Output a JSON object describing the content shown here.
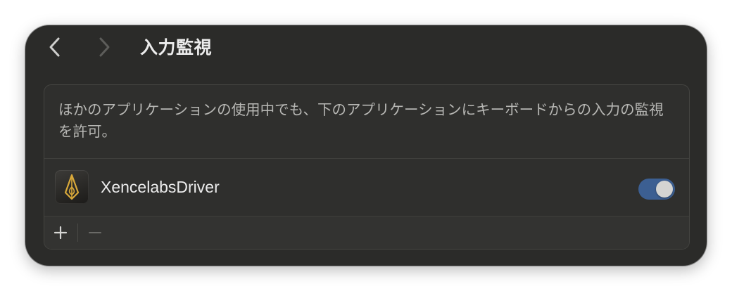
{
  "toolbar": {
    "title": "入力監視",
    "back_icon": "chevron-left-icon",
    "forward_icon": "chevron-right-icon"
  },
  "panel": {
    "description": "ほかのアプリケーションの使用中でも、下のアプリケーションにキーボードからの入力の監視を許可。",
    "apps": [
      {
        "name": "XencelabsDriver",
        "icon": "xencelabs-pen-icon",
        "enabled": true
      }
    ],
    "footer": {
      "add_icon": "plus-icon",
      "remove_icon": "minus-icon"
    }
  },
  "colors": {
    "window_bg": "#2b2b29",
    "panel_bg": "#2f2f2d",
    "toggle_on": "#3c5f92",
    "icon_accent": "#d9a93a",
    "text_primary": "#ececec",
    "text_secondary": "#b7b7b4"
  }
}
